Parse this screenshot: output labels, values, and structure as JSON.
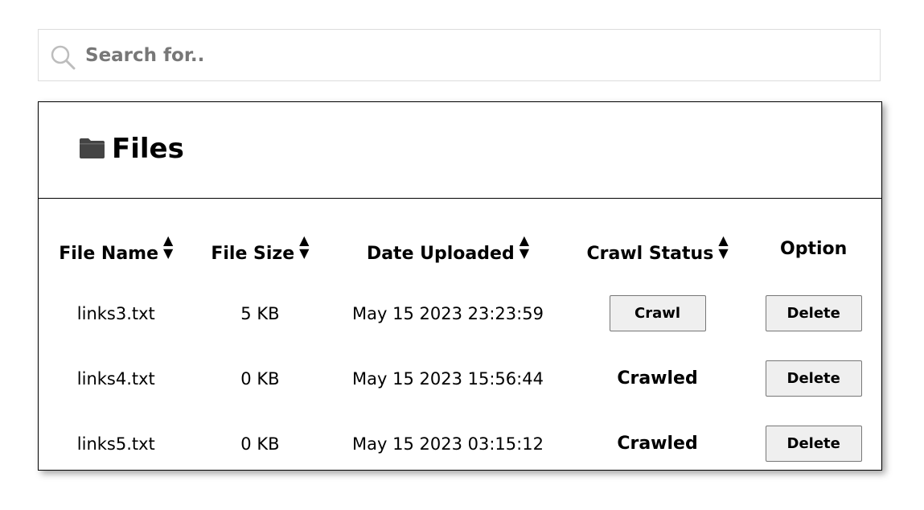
{
  "search": {
    "placeholder": "Search for.."
  },
  "files_panel": {
    "title": "Files",
    "columns": {
      "name": "File Name",
      "size": "File Size",
      "date": "Date Uploaded",
      "status": "Crawl Status",
      "option": "Option"
    },
    "rows": [
      {
        "name": "links3.txt",
        "size": "5 KB",
        "date": "May 15 2023 23:23:59",
        "status_button": "Crawl",
        "status_text": "",
        "option": "Delete"
      },
      {
        "name": "links4.txt",
        "size": "0 KB",
        "date": "May 15 2023 15:56:44",
        "status_button": "",
        "status_text": "Crawled",
        "option": "Delete"
      },
      {
        "name": "links5.txt",
        "size": "0 KB",
        "date": "May 15 2023 03:15:12",
        "status_button": "",
        "status_text": "Crawled",
        "option": "Delete"
      }
    ]
  },
  "icons": {
    "search": "search-icon",
    "folder": "folder-icon",
    "sort": "sort-icon"
  },
  "colors": {
    "placeholder": "#777777",
    "button_bg": "#efefef",
    "border": "#000000",
    "icon": "#444444"
  }
}
